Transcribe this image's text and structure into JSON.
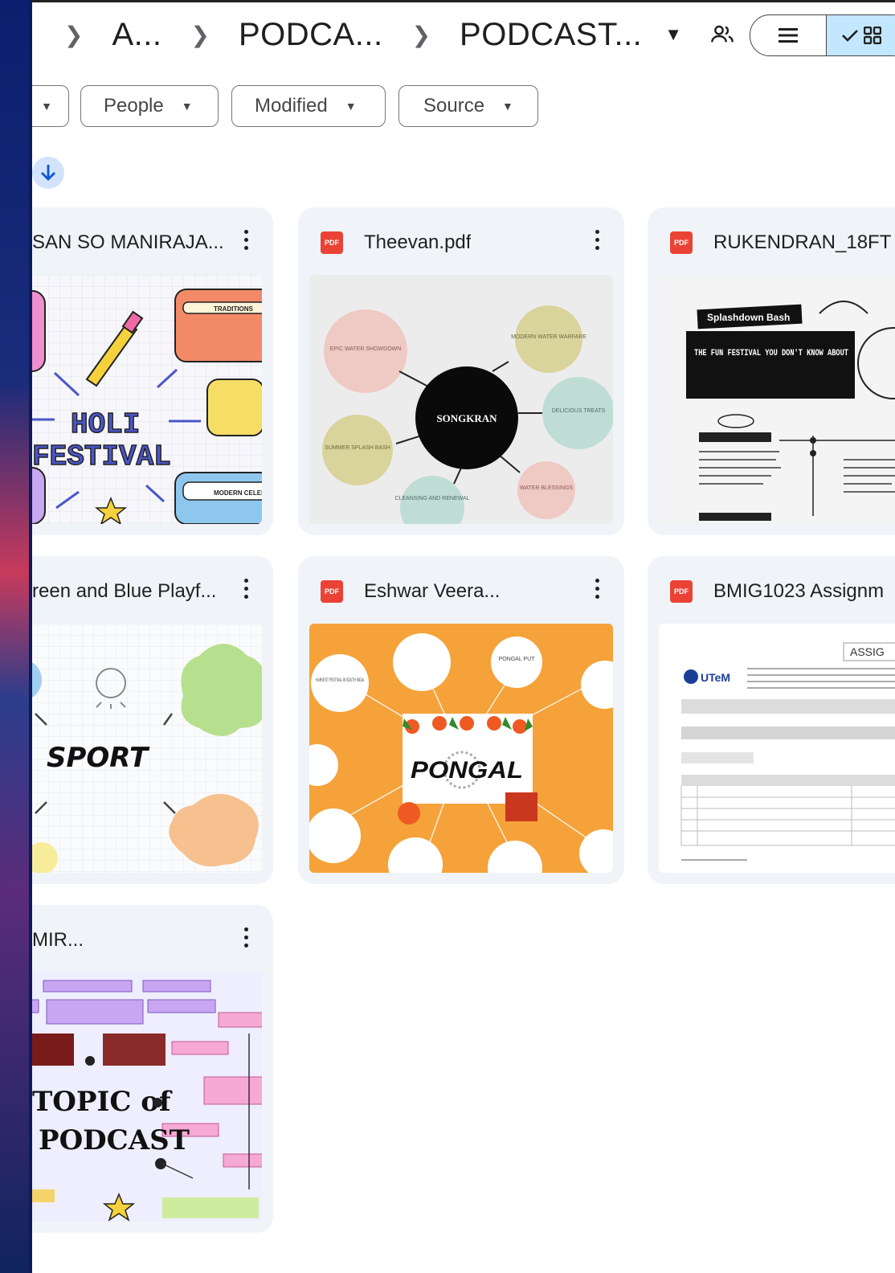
{
  "breadcrumb": {
    "items": [
      "A...",
      "PODCA...",
      "PODCAST..."
    ]
  },
  "filters": [
    {
      "label": "People"
    },
    {
      "label": "Modified"
    },
    {
      "label": "Source"
    }
  ],
  "files": [
    {
      "title": "SAN SO MANIRAJA...",
      "type": "image",
      "thumb_text": [
        "HOLI",
        "FESTIVAL",
        "TRADITIONS",
        "MODERN CELEBRATION"
      ]
    },
    {
      "title": "Theevan.pdf",
      "type": "pdf",
      "badge": "PDF",
      "thumb_text": [
        "SONGKRAN",
        "EPIC WATER SHOWDOWN",
        "MODERN WATER WARFARE",
        "DELICIOUS TREATS",
        "WATER BLESSINGS",
        "CLEANSING AND RENEWAL",
        "SUMMER SPLASH BASH"
      ]
    },
    {
      "title": "RUKENDRAN_18FT",
      "type": "pdf",
      "badge": "PDF",
      "thumb_text": [
        "Splashdown Bash",
        "THE FUN FESTIVAL YOU DON'T KNOW ABOUT"
      ]
    },
    {
      "title": "reen and Blue Playf...",
      "type": "image",
      "thumb_text": [
        "SPORT"
      ]
    },
    {
      "title": "Eshwar Veera...",
      "type": "pdf",
      "badge": "PDF",
      "thumb_text": [
        "PONGAL",
        "PONGAL PUT",
        "HARVEST FESTIVAL IN SOUTH INDIA"
      ]
    },
    {
      "title": "BMIG1023 Assignm",
      "type": "pdf",
      "badge": "PDF",
      "thumb_text": [
        "ASSIG",
        "UTeM"
      ]
    },
    {
      "title": "MIR...",
      "type": "image",
      "thumb_text": [
        "TOPIC of",
        "PODCAST"
      ]
    }
  ]
}
